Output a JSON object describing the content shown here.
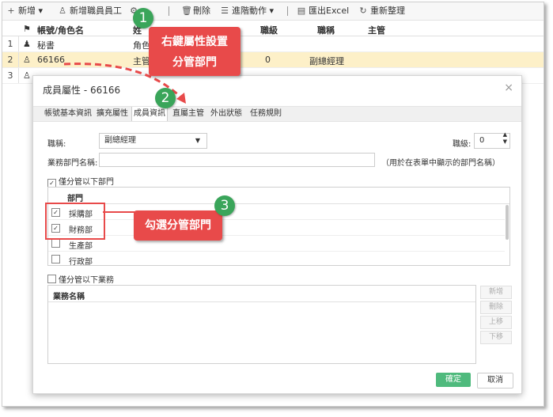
{
  "toolbar": {
    "add": "新增",
    "add_employee": "新增職員員工",
    "delete": "刪除",
    "advanced": "進階動作",
    "export": "匯出Excel",
    "refresh": "重新整理"
  },
  "grid": {
    "headers": {
      "account": "帳號/角色名",
      "name_partial": "姓",
      "level": "職級",
      "title": "職稱",
      "manager": "主管"
    },
    "rows": [
      {
        "num": "1",
        "account": "秘書",
        "col2": "角色"
      },
      {
        "num": "2",
        "account": "66166",
        "col2": "主管",
        "level": "0",
        "title": "副總經理"
      },
      {
        "num": "3"
      }
    ]
  },
  "callouts": {
    "one": {
      "num": "1",
      "line1": "右鍵屬性設置",
      "line2": "分管部門"
    },
    "two": {
      "num": "2"
    },
    "three": {
      "num": "3",
      "text": "勾選分管部門"
    }
  },
  "dialog": {
    "title": "成員屬性 - 66166",
    "close": "×",
    "tabs": [
      "帳號基本資訊",
      "擴充屬性",
      "成員資訊",
      "直屬主管",
      "外出狀態",
      "任務規則"
    ],
    "active_tab": "成員資訊",
    "position_label": "職稱:",
    "position_value": "副總經理",
    "level_label": "職級:",
    "level_value": "0",
    "dept_name_label": "業務部門名稱:",
    "dept_name_hint": "（用於在表單中顯示的部門名稱）",
    "manage_depts_label": "僅分管以下部門",
    "dept_col_header": "部門",
    "departments": [
      {
        "name": "採購部",
        "checked": true
      },
      {
        "name": "財務部",
        "checked": true
      },
      {
        "name": "生產部",
        "checked": false
      },
      {
        "name": "行政部",
        "checked": false
      }
    ],
    "manage_business_label": "僅分管以下業務",
    "business_col_header": "業務名稱",
    "side_buttons": {
      "add": "新增",
      "delete": "刪除",
      "up": "上移",
      "down": "下移"
    },
    "ok": "確定",
    "cancel": "取消"
  },
  "colors": {
    "accent_green": "#3aa55a",
    "callout_red": "#e84a4a",
    "selected_row": "#fdf0c8",
    "ok_button": "#4fba7d"
  }
}
